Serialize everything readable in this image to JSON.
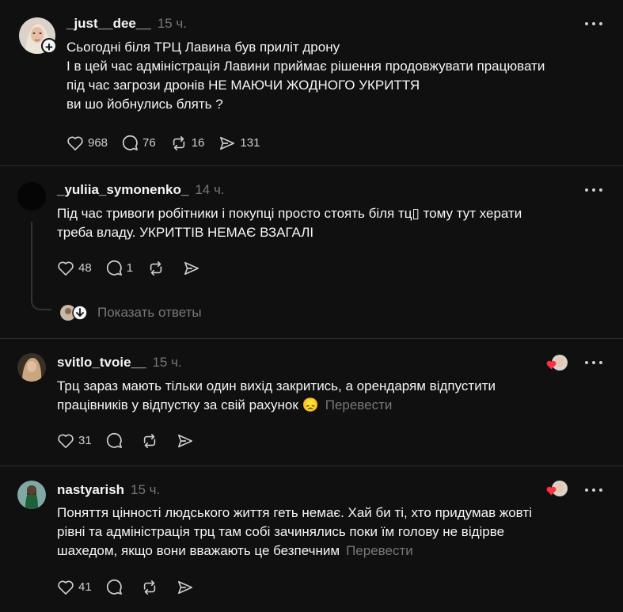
{
  "comments": [
    {
      "username": "_just__dee__",
      "time": "15 ч.",
      "lines": [
        "Сьогодні біля ТРЦ Лавина був приліт дрону",
        "І в цей час адміністрація Лавини приймає рішення продовжувати працювати",
        "під час загрози дронів НЕ МАЮЧИ ЖОДНОГО УКРИТТЯ",
        "ви шо йобнулись блять ?"
      ],
      "likes": "968",
      "replies": "76",
      "reposts": "16",
      "shares": "131"
    },
    {
      "username": "_yuliia_symonenko_",
      "time": "14 ч.",
      "lines": [
        "Під час тривоги робітники і покупці просто стоять біля тц▯ тому тут херати",
        "треба владу. УКРИТТІВ НЕМАЄ ВЗАГАЛІ"
      ],
      "likes": "48",
      "replies": "1",
      "show_replies": "Показать ответы"
    },
    {
      "username": "svitlo_tvoie__",
      "time": "15 ч.",
      "lines": [
        "Трц зараз мають тільки один вихід закритись, а орендарям відпустити",
        "працівників у відпустку за свій рахунок"
      ],
      "emoji": "😞",
      "translate": "Перевести",
      "likes": "31"
    },
    {
      "username": "nastyarish",
      "time": "15 ч.",
      "lines": [
        "Поняття цінності людського життя геть немає. Хай би ті, хто придумав жовті",
        "рівні та адміністрація трц там собі зачинялись поки їм голову не відірве",
        "шахедом, якщо вони вважають це безпечним"
      ],
      "translate": "Перевести",
      "likes": "41"
    }
  ],
  "colors": {
    "background": "#101010",
    "text": "#f3f5f7",
    "muted": "#777777",
    "heart": "#ff3040"
  }
}
